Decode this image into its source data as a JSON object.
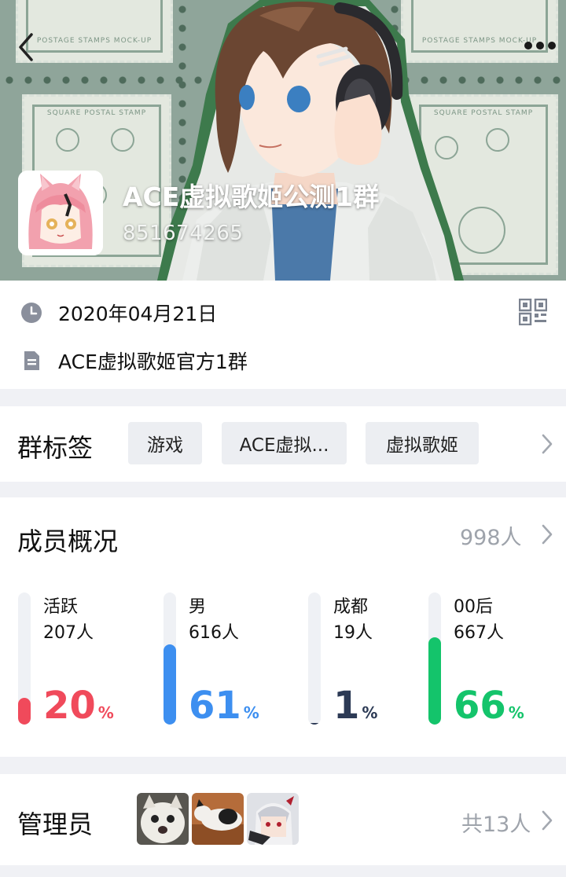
{
  "header": {
    "group_name": "ACE虚拟歌姬公测1群",
    "group_id": "851674265",
    "stamp_labels": {
      "mockup": "POSTAGE STAMPS MOCK-UP",
      "square": "SQUARE POSTAL STAMP"
    },
    "icons": {
      "back": "chevron-left-icon",
      "more": "more-dots-icon"
    }
  },
  "info": {
    "date": "2020年04月21日",
    "description": "ACE虚拟歌姬官方1群",
    "icons": {
      "date": "clock-icon",
      "description": "document-icon",
      "qr": "qr-code-icon"
    }
  },
  "tags": {
    "title": "群标签",
    "items": [
      "游戏",
      "ACE虚拟...",
      "虚拟歌姬"
    ]
  },
  "members": {
    "title": "成员概况",
    "total": "998人",
    "stats": [
      {
        "label": "活跃",
        "count": "207人",
        "percent": "20",
        "unit": "%",
        "color": "#f04a5b",
        "fill": 0.2
      },
      {
        "label": "男",
        "count": "616人",
        "percent": "61",
        "unit": "%",
        "color": "#3d8ff0",
        "fill": 0.61
      },
      {
        "label": "成都",
        "count": "19人",
        "percent": "1",
        "unit": "%",
        "color": "#2c3a55",
        "fill": 0.01
      },
      {
        "label": "00后",
        "count": "667人",
        "percent": "66",
        "unit": "%",
        "color": "#14c46b",
        "fill": 0.66
      }
    ]
  },
  "admins": {
    "title": "管理员",
    "total": "共13人"
  }
}
